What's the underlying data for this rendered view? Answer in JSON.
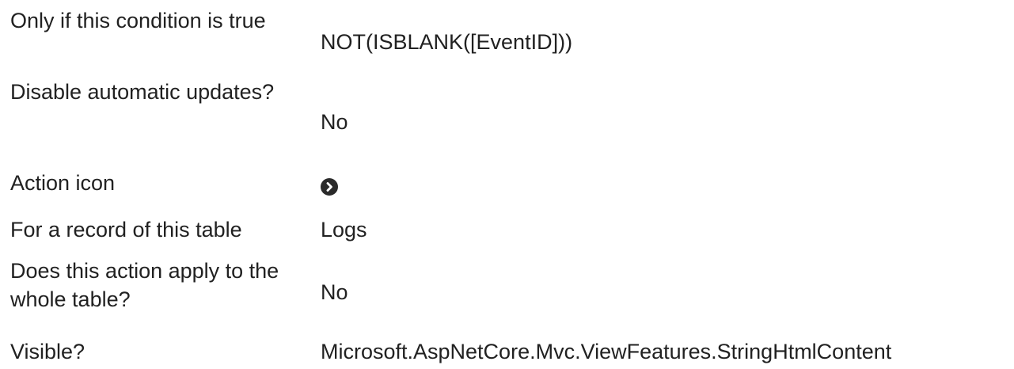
{
  "properties": {
    "rows": [
      {
        "label": "Only if this condition is true",
        "value": "NOT(ISBLANK([EventID]))"
      },
      {
        "label": "Disable automatic updates?",
        "value": "No"
      },
      {
        "label": "Action icon",
        "value": "",
        "icon": "chevron-right-circle-icon"
      },
      {
        "label": "For a record of this table",
        "value": "Logs"
      },
      {
        "label": "Does this action apply to the whole table?",
        "value": "No"
      },
      {
        "label": "Visible?",
        "value": "Microsoft.AspNetCore.Mvc.ViewFeatures.StringHtmlContent"
      }
    ]
  }
}
